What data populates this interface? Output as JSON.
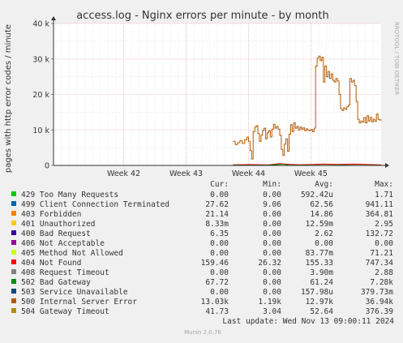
{
  "chart_data": {
    "type": "line",
    "title": "access.log - Nginx errors per minute - by month",
    "ylabel": "pages with http error codes / minute",
    "xlabel": "",
    "ylim": [
      0,
      40000
    ],
    "y_ticks": [
      {
        "value": 0,
        "label": "0"
      },
      {
        "value": 10000,
        "label": "10 k"
      },
      {
        "value": 20000,
        "label": "20 k"
      },
      {
        "value": 30000,
        "label": "30 k"
      },
      {
        "value": 40000,
        "label": "40 k"
      }
    ],
    "x_range": [
      0,
      42
    ],
    "x_ticks": [
      {
        "value": 9,
        "label": "Week 42"
      },
      {
        "value": 17,
        "label": "Week 43"
      },
      {
        "value": 25,
        "label": "Week 44"
      },
      {
        "value": 33,
        "label": "Week 45"
      }
    ],
    "grid": true,
    "side_label": "RRDTOOL / TOBI OETIKER",
    "footer": "Munin 2.0.76",
    "last_update": "Last update:  Wed Nov 13 09:00:11 2024",
    "legend_headers": {
      "cur": "Cur:",
      "min": "Min:",
      "avg": "Avg:",
      "max": "Max:"
    },
    "series": [
      {
        "name": "429 Too Many Requests",
        "color": "#00cc00",
        "cur": "0.00",
        "min": "0.00",
        "avg": "592.42u",
        "max": "1.71"
      },
      {
        "name": "499 Client Connection Terminated",
        "color": "#0066b3",
        "cur": "27.62",
        "min": "9.06",
        "avg": "62.56",
        "max": "941.11"
      },
      {
        "name": "403 Forbidden",
        "color": "#ff8000",
        "cur": "21.14",
        "min": "0.00",
        "avg": "14.86",
        "max": "364.81"
      },
      {
        "name": "401 Unauthorized",
        "color": "#ffcc00",
        "cur": "8.33m",
        "min": "0.00",
        "avg": "12.59m",
        "max": "2.95"
      },
      {
        "name": "400 Bad Request",
        "color": "#330099",
        "cur": "6.35",
        "min": "0.00",
        "avg": "2.62",
        "max": "132.72"
      },
      {
        "name": "406 Not Acceptable",
        "color": "#990099",
        "cur": "0.00",
        "min": "0.00",
        "avg": "0.00",
        "max": "0.00"
      },
      {
        "name": "405 Method Not Allowed",
        "color": "#ccff00",
        "cur": "0.00",
        "min": "0.00",
        "avg": "83.77m",
        "max": "71.21"
      },
      {
        "name": "404 Not Found",
        "color": "#ff0000",
        "cur": "159.46",
        "min": "26.32",
        "avg": "155.33",
        "max": "747.34"
      },
      {
        "name": "408 Request Timeout",
        "color": "#808080",
        "cur": "0.00",
        "min": "0.00",
        "avg": "3.90m",
        "max": "2.88"
      },
      {
        "name": "502 Bad Gateway",
        "color": "#008f00",
        "cur": "67.72",
        "min": "0.00",
        "avg": "61.24",
        "max": "7.28k"
      },
      {
        "name": "503 Service Unavailable",
        "color": "#00487d",
        "cur": "0.00",
        "min": "0.00",
        "avg": "157.98u",
        "max": "379.73m"
      },
      {
        "name": "500 Internal Server Error",
        "color": "#b35a00",
        "cur": "13.03k",
        "min": "1.19k",
        "avg": "12.97k",
        "max": "36.94k"
      },
      {
        "name": "504 Gateway Timeout",
        "color": "#b38f00",
        "cur": "41.73",
        "min": "3.04",
        "avg": "52.64",
        "max": "376.39"
      }
    ],
    "main_series": {
      "name": "500 Internal Server Error",
      "points": [
        [
          23.0,
          6800
        ],
        [
          23.3,
          5900
        ],
        [
          23.6,
          6400
        ],
        [
          23.9,
          7000
        ],
        [
          24.2,
          6200
        ],
        [
          24.5,
          7200
        ],
        [
          24.8,
          8000
        ],
        [
          25.0,
          6800
        ],
        [
          25.2,
          4200
        ],
        [
          25.4,
          1800
        ],
        [
          25.6,
          9500
        ],
        [
          25.8,
          10800
        ],
        [
          26.0,
          11200
        ],
        [
          26.2,
          9000
        ],
        [
          26.4,
          6800
        ],
        [
          26.6,
          8500
        ],
        [
          26.8,
          9800
        ],
        [
          27.0,
          10500
        ],
        [
          27.2,
          7500
        ],
        [
          27.4,
          9200
        ],
        [
          27.6,
          9800
        ],
        [
          27.8,
          8000
        ],
        [
          28.0,
          10200
        ],
        [
          28.2,
          11600
        ],
        [
          28.4,
          10500
        ],
        [
          28.6,
          11000
        ],
        [
          28.8,
          10200
        ],
        [
          29.0,
          8500
        ],
        [
          29.2,
          4500
        ],
        [
          29.4,
          2800
        ],
        [
          29.6,
          6000
        ],
        [
          29.8,
          7500
        ],
        [
          30.0,
          4000
        ],
        [
          30.2,
          8800
        ],
        [
          30.4,
          11500
        ],
        [
          30.6,
          9500
        ],
        [
          30.8,
          12000
        ],
        [
          31.0,
          10500
        ],
        [
          31.2,
          11000
        ],
        [
          31.4,
          10000
        ],
        [
          31.6,
          10800
        ],
        [
          31.8,
          10200
        ],
        [
          32.0,
          10600
        ],
        [
          32.2,
          9800
        ],
        [
          32.4,
          10300
        ],
        [
          32.6,
          10000
        ],
        [
          32.8,
          9800
        ],
        [
          33.0,
          10100
        ],
        [
          33.2,
          9500
        ],
        [
          33.4,
          10500
        ],
        [
          33.6,
          28000
        ],
        [
          33.8,
          30200
        ],
        [
          34.0,
          30800
        ],
        [
          34.2,
          29500
        ],
        [
          34.4,
          30500
        ],
        [
          34.6,
          23500
        ],
        [
          34.8,
          28000
        ],
        [
          35.0,
          25000
        ],
        [
          35.2,
          26500
        ],
        [
          35.4,
          24500
        ],
        [
          35.6,
          25800
        ],
        [
          35.8,
          24000
        ],
        [
          36.0,
          23500
        ],
        [
          36.2,
          24500
        ],
        [
          36.4,
          23800
        ],
        [
          36.6,
          20000
        ],
        [
          36.8,
          16000
        ],
        [
          37.0,
          15500
        ],
        [
          37.2,
          16200
        ],
        [
          37.4,
          15800
        ],
        [
          37.6,
          16500
        ],
        [
          37.8,
          17000
        ],
        [
          38.0,
          24500
        ],
        [
          38.2,
          23500
        ],
        [
          38.4,
          24000
        ],
        [
          38.6,
          22500
        ],
        [
          38.8,
          18000
        ],
        [
          39.0,
          13000
        ],
        [
          39.2,
          12000
        ],
        [
          39.4,
          12500
        ],
        [
          39.6,
          12200
        ],
        [
          39.8,
          13500
        ],
        [
          40.0,
          12000
        ],
        [
          40.2,
          14000
        ],
        [
          40.4,
          12500
        ],
        [
          40.6,
          13500
        ],
        [
          40.8,
          12300
        ],
        [
          41.0,
          13000
        ],
        [
          41.2,
          12400
        ],
        [
          41.4,
          14500
        ],
        [
          41.6,
          13000
        ],
        [
          41.8,
          12800
        ],
        [
          42.0,
          13000
        ]
      ]
    },
    "minor_series": [
      {
        "name": "404 Not Found",
        "points": [
          [
            23.0,
            150
          ],
          [
            25.0,
            260
          ],
          [
            27.5,
            180
          ],
          [
            29.0,
            520
          ],
          [
            30.2,
            320
          ],
          [
            31.5,
            210
          ],
          [
            33.4,
            280
          ],
          [
            34.5,
            420
          ],
          [
            36.5,
            300
          ],
          [
            38.5,
            380
          ],
          [
            40.5,
            240
          ],
          [
            42.0,
            160
          ]
        ]
      },
      {
        "name": "502 Bad Gateway",
        "points": [
          [
            23.0,
            40
          ],
          [
            25.0,
            80
          ],
          [
            27.0,
            60
          ],
          [
            29.5,
            350
          ],
          [
            30.0,
            120
          ],
          [
            32.0,
            60
          ],
          [
            33.5,
            90
          ],
          [
            35.0,
            70
          ],
          [
            37.0,
            110
          ],
          [
            39.0,
            60
          ],
          [
            41.0,
            80
          ],
          [
            42.0,
            68
          ]
        ]
      }
    ]
  }
}
